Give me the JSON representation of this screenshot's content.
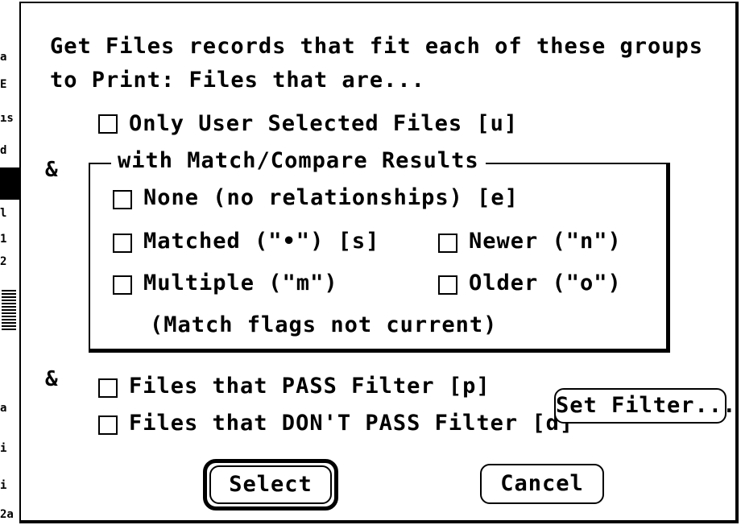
{
  "heading": {
    "line1": "Get Files records that fit each of these groups",
    "line2": "to Print:   Files that are..."
  },
  "only_user_selected": {
    "label": "Only User Selected Files  [u]",
    "checked": false
  },
  "amp_symbol": "&",
  "match_group": {
    "legend": "with Match/Compare Results",
    "none": {
      "label": "None (no relationships) [e]",
      "checked": false
    },
    "matched": {
      "label": "Matched  (\"•\") [s]",
      "checked": false
    },
    "newer": {
      "label": "Newer (\"n\")",
      "checked": false
    },
    "multiple": {
      "label": "Multiple (\"m\")",
      "checked": false
    },
    "older": {
      "label": "Older (\"o\")",
      "checked": false
    },
    "note": "(Match flags not current)"
  },
  "filter": {
    "pass": {
      "label": "Files that PASS Filter [p]",
      "checked": false
    },
    "dont_pass": {
      "label": "Files that DON'T PASS Filter [d]",
      "checked": false
    },
    "set_filter_button": "Set Filter..."
  },
  "buttons": {
    "select": "Select",
    "cancel": "Cancel"
  },
  "background_window_fragments": [
    "a",
    "E",
    "ıs",
    "d",
    "l",
    "1",
    "2",
    "a",
    "i",
    "i",
    "2a"
  ]
}
